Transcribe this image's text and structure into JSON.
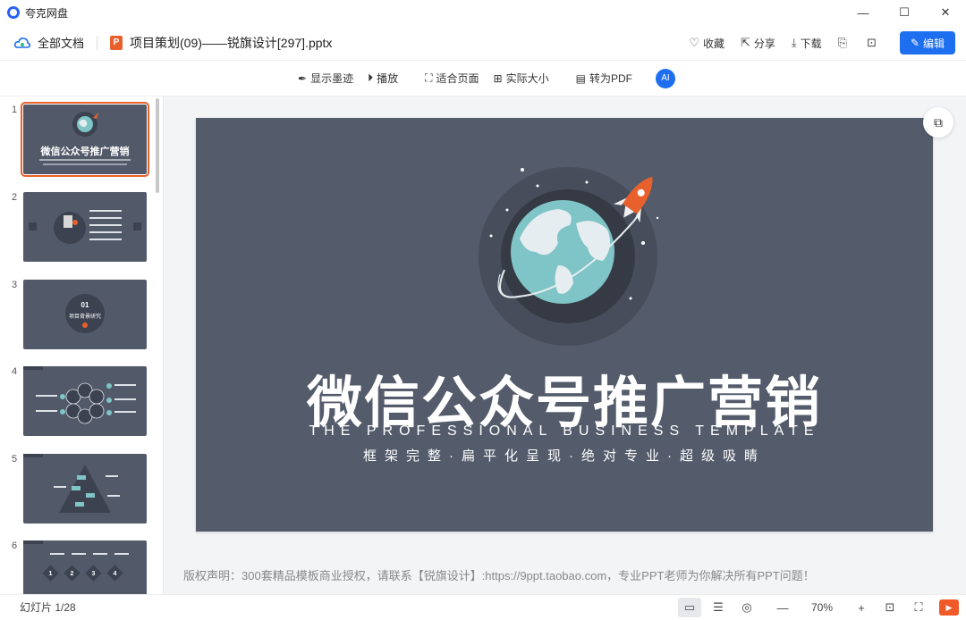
{
  "window": {
    "title": "夸克网盘",
    "minimize": "—",
    "maximize": "☐",
    "close": "✕"
  },
  "header": {
    "all_docs": "全部文档",
    "file_icon": "P",
    "file_name": "项目策划(09)——锐旗设计[297].pptx",
    "collect": "收藏",
    "share": "分享",
    "download": "下载",
    "edit": "编辑"
  },
  "toolbar": {
    "show_ink": "显示墨迹",
    "play": "播放",
    "fit_page": "适合页面",
    "actual_size": "实际大小",
    "to_pdf": "转为PDF",
    "ai": "AI"
  },
  "thumbnails": [
    {
      "num": "1",
      "title": "微信公众号推广营销"
    },
    {
      "num": "2"
    },
    {
      "num": "3",
      "label": "01",
      "caption": "项目背景研究"
    },
    {
      "num": "4"
    },
    {
      "num": "5"
    },
    {
      "num": "6",
      "steps": [
        "1",
        "2",
        "3",
        "4"
      ]
    }
  ],
  "slide": {
    "title": "微信公众号推广营销",
    "subtitle": "THE PROFESSIONAL BUSINESS TEMPLATE",
    "tagline": "框架完整·扁平化呈现·绝对专业·超级吸睛",
    "bg_color": "#545b6b",
    "accent": "#e8612c"
  },
  "copyright": "版权声明：300套精品模板商业授权，请联系【锐旗设计】:https://9ppt.taobao.com，专业PPT老师为你解决所有PPT问题！",
  "status": {
    "slide_count": "幻灯片 1/28",
    "zoom_out": "—",
    "zoom": "70%",
    "zoom_in": "+"
  }
}
